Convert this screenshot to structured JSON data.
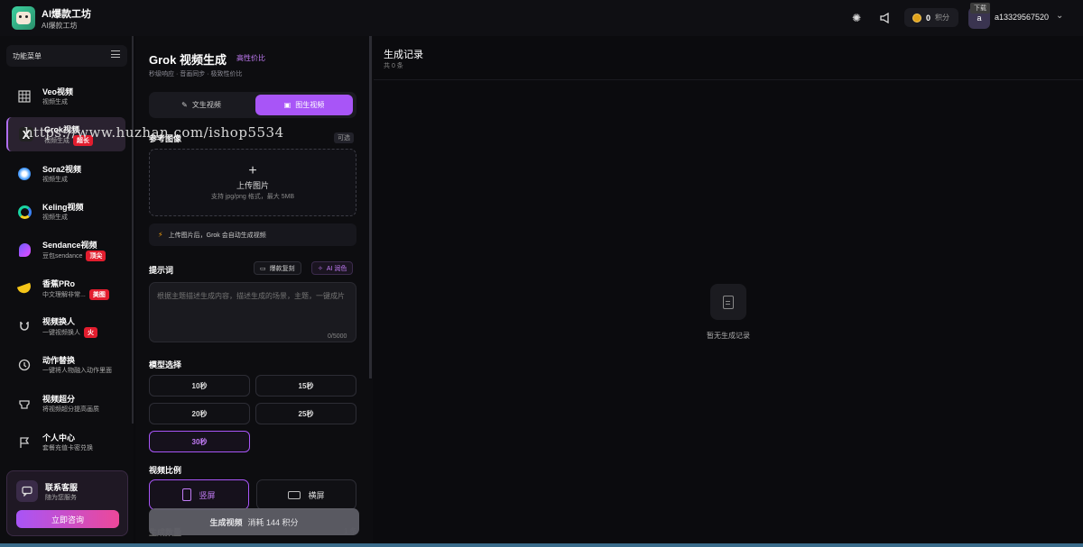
{
  "app": {
    "title": "AI爆款工坊",
    "subtitle": "AI爆款工坊"
  },
  "header": {
    "points_value": "0",
    "points_unit": "积分",
    "avatar_letter": "a",
    "download_tip": "下载",
    "username": "a13329567520"
  },
  "sidebar": {
    "menu_title": "功能菜单",
    "items": [
      {
        "title": "Veo视频",
        "sub": "视频生成",
        "badge": ""
      },
      {
        "title": "Grok视频",
        "sub": "视频生成",
        "badge": "超长"
      },
      {
        "title": "Sora2视频",
        "sub": "视频生成",
        "badge": ""
      },
      {
        "title": "Keling视频",
        "sub": "视频生成",
        "badge": ""
      },
      {
        "title": "Sendance视频",
        "sub": "豆包sendance",
        "badge": "顶尖"
      },
      {
        "title": "香蕉PRo",
        "sub": "中文理解非常...",
        "badge": "美图"
      },
      {
        "title": "视频换人",
        "sub": "一键视频换人",
        "badge": "火"
      },
      {
        "title": "动作替换",
        "sub": "一键将人物融入动作里面",
        "badge": ""
      },
      {
        "title": "视频超分",
        "sub": "将视频超分提高画质",
        "badge": ""
      },
      {
        "title": "个人中心",
        "sub": "套餐充值卡密兑换",
        "badge": ""
      }
    ],
    "service": {
      "title": "联系客服",
      "sub": "随为您服务",
      "button": "立即咨询"
    }
  },
  "panel": {
    "title": "Grok 视频生成",
    "tag": "高性价比",
    "subtitle": "秒级响应 · 音画同步 · 极致性价比",
    "modes": [
      "文生视频",
      "图生视频"
    ],
    "ref_label": "参考图像",
    "optional": "可选",
    "upload_title": "上传图片",
    "upload_hint": "支持 jpg/png 格式，最大 5MB",
    "tip": "上传图片后，Grok 会自动生成视频",
    "prompt_label": "提示词",
    "copy_btn": "爆款复刻",
    "ai_btn": "AI 润色",
    "prompt_placeholder": "根据主题描述生成内容，描述生成的场景，主题，一键成片",
    "counter": "0/5000",
    "model_label": "模型选择",
    "durations": [
      "10秒",
      "15秒",
      "20秒",
      "25秒",
      "30秒"
    ],
    "ratio_label": "视频比例",
    "ratios": [
      "竖屏",
      "横屏"
    ],
    "gen_button": "生成视频",
    "gen_cost": "消耗 144 积分",
    "gen_count_label": "生成数量",
    "gen_count_value": "1 条"
  },
  "records": {
    "title": "生成记录",
    "count": "共 0 条",
    "empty": "暂无生成记录"
  },
  "watermark": "https://www.huzhan.com/ishop5534",
  "colors": {
    "accent": "#a855f7",
    "badge_red": "#e21d2e",
    "gradient_end": "#ec4899"
  }
}
